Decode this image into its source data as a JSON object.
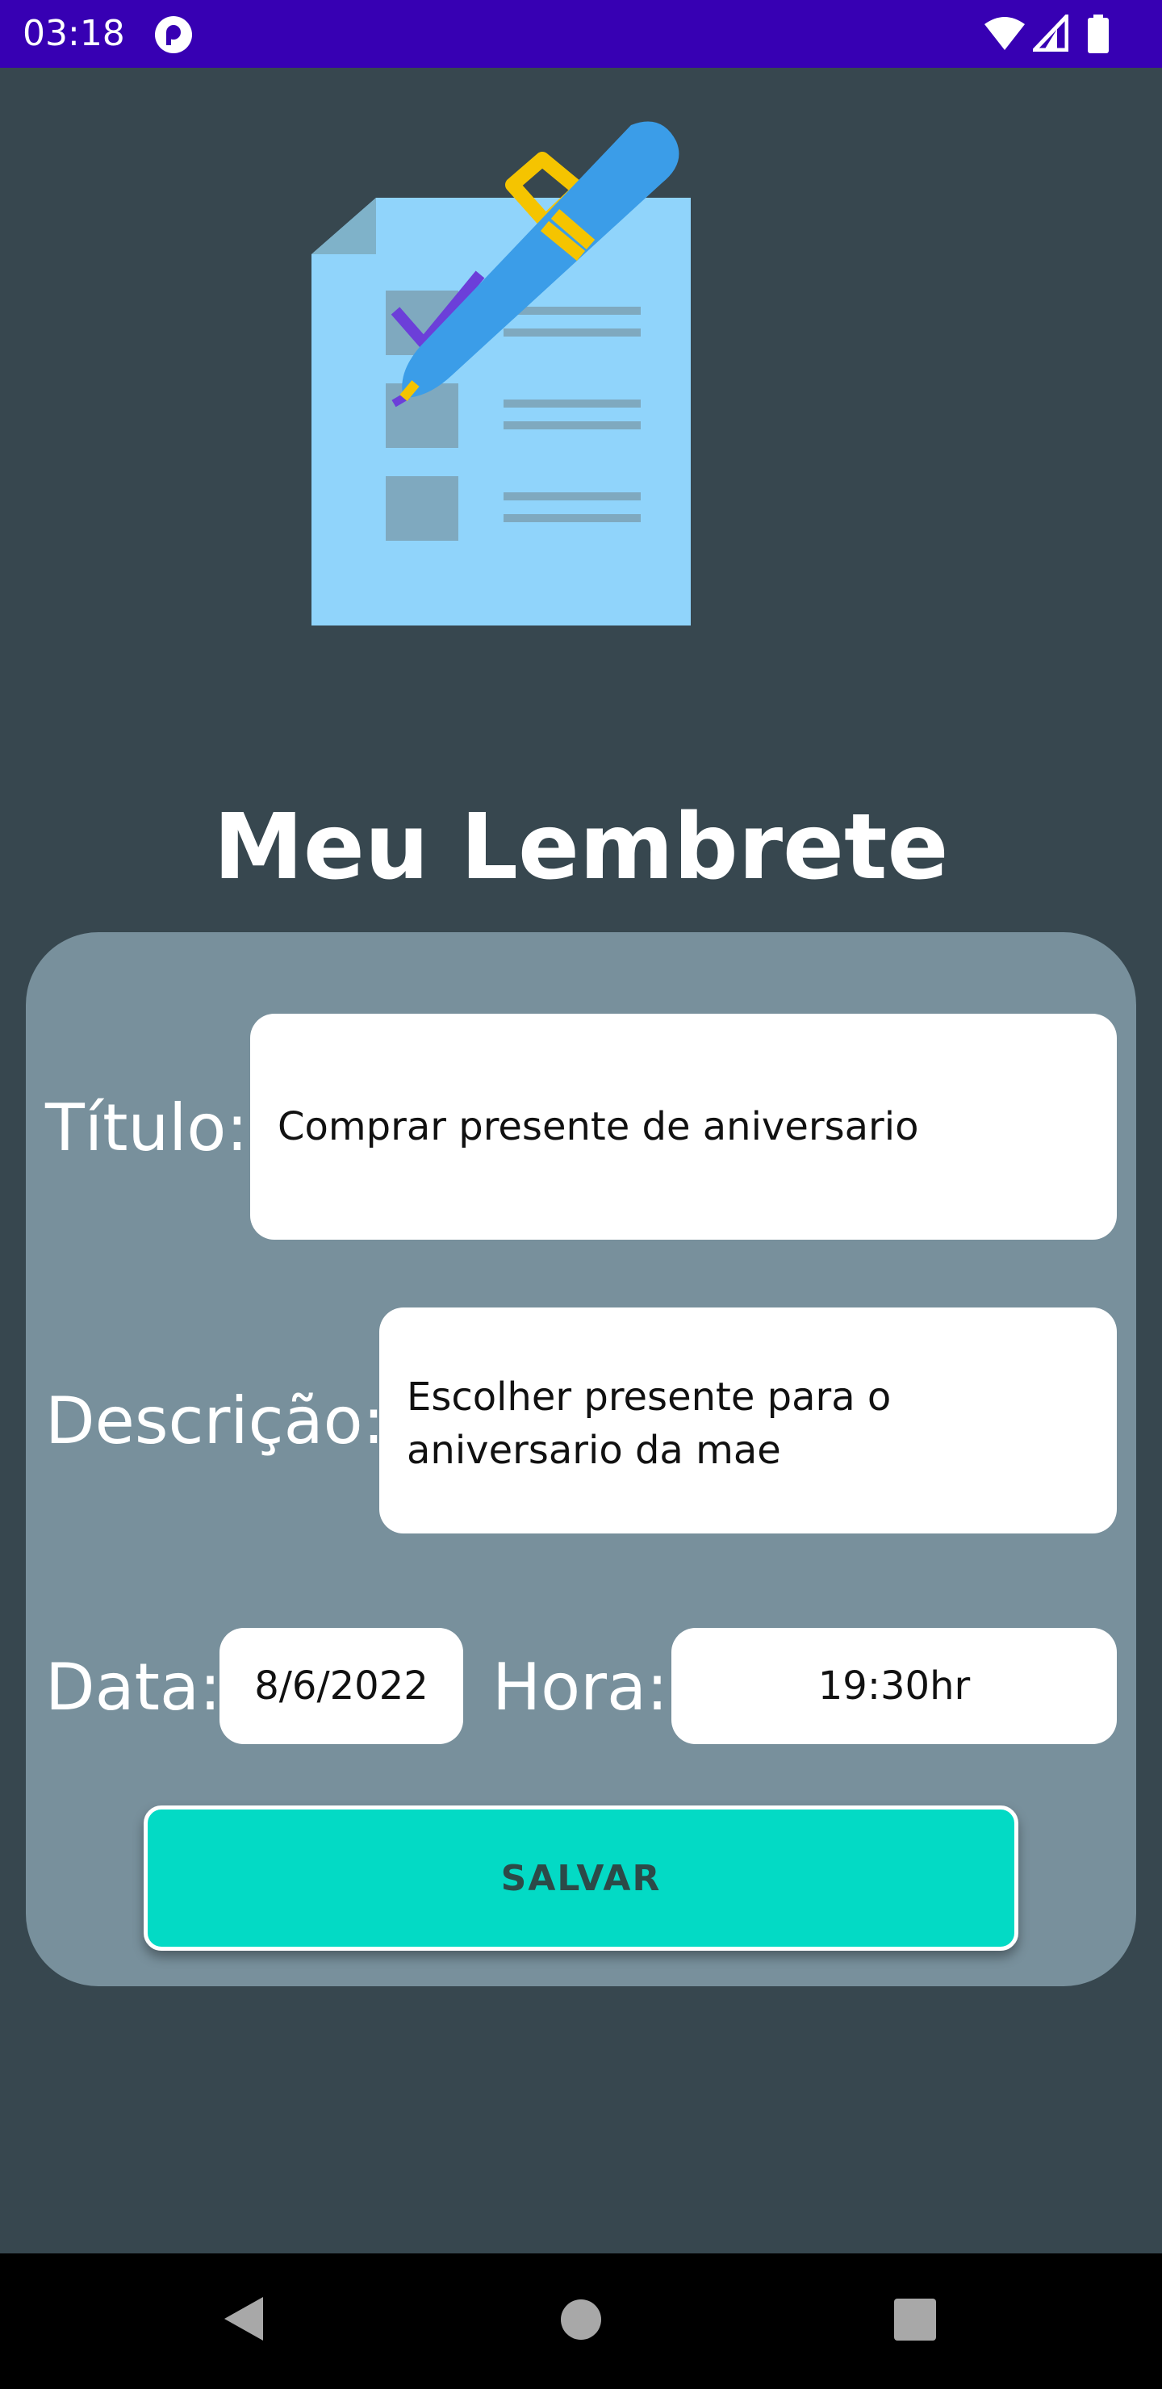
{
  "status_bar": {
    "time": "03:18",
    "icons": [
      "app-notification-icon",
      "wifi-icon",
      "cellular-signal-icon",
      "battery-icon"
    ]
  },
  "hero": {
    "icon": "checklist-with-pen-illustration"
  },
  "title": "Meu Lembrete",
  "form": {
    "titulo": {
      "label": "Título:",
      "value": "Comprar presente de aniversario"
    },
    "descricao": {
      "label": "Descrição:",
      "value_line1": "Escolher presente para o",
      "value_line2": "aniversario da mae"
    },
    "data": {
      "label": "Data:",
      "value": "8/6/2022"
    },
    "hora": {
      "label": "Hora:",
      "value": "19:30hr"
    },
    "save_label": "SALVAR"
  },
  "nav": {
    "icons": [
      "back-icon",
      "home-icon",
      "recents-icon"
    ]
  },
  "colors": {
    "status_bar": "#3700b3",
    "background": "#37474f",
    "card": "#78909c",
    "button": "#03dac5",
    "nav_bar": "#000000"
  }
}
